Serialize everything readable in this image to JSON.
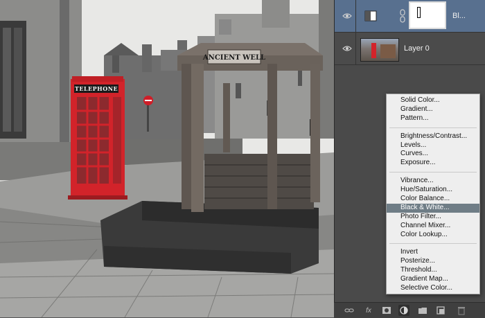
{
  "photo": {
    "booth_label": "TELEPHONE",
    "well_sign": "ANCIENT WELL"
  },
  "layers": [
    {
      "name": "Bl...",
      "type": "adjustment",
      "selected": true,
      "icon": "black-white-adjustment-icon"
    },
    {
      "name": "Layer 0",
      "type": "pixel",
      "selected": false,
      "icon": "photo-thumbnail"
    }
  ],
  "menu": {
    "groups": [
      [
        "Solid Color...",
        "Gradient...",
        "Pattern..."
      ],
      [
        "Brightness/Contrast...",
        "Levels...",
        "Curves...",
        "Exposure..."
      ],
      [
        "Vibrance...",
        "Hue/Saturation...",
        "Color Balance...",
        "Black & White...",
        "Photo Filter...",
        "Channel Mixer...",
        "Color Lookup..."
      ],
      [
        "Invert",
        "Posterize...",
        "Threshold...",
        "Gradient Map...",
        "Selective Color..."
      ]
    ],
    "selected": "Black & White..."
  },
  "toolbar": {
    "buttons": [
      "link-icon",
      "fx",
      "add-mask-icon",
      "adjustment-layer-icon",
      "folder-icon",
      "new-layer-icon",
      "trash-icon"
    ]
  },
  "colors": {
    "booth_red": "#d2232a",
    "selected_layer": "#58708f",
    "menu_highlight": "#6f7d86"
  }
}
